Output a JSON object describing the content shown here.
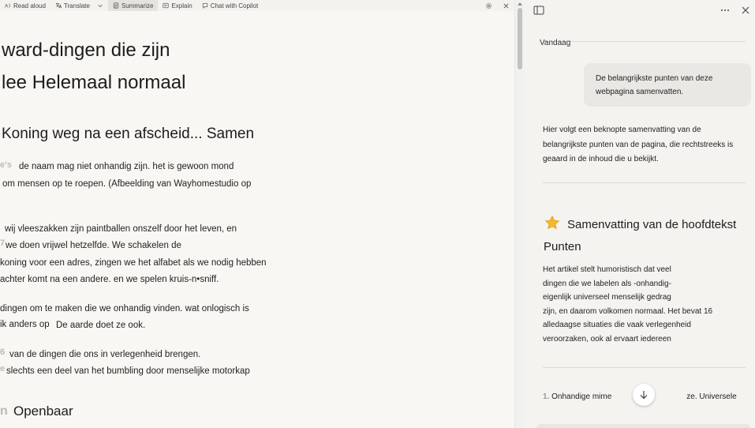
{
  "toolbar": {
    "read_aloud": "Read aloud",
    "translate": "Translate",
    "summarize": "Summarize",
    "explain": "Explain",
    "chat": "Chat with Copilot"
  },
  "article": {
    "headline_1": "ward-dingen die zijn",
    "headline_2": "lee Helemaal normaal",
    "subhead_1": "Koning weg na een afscheid... Samen",
    "subhead_2": "Openbaar",
    "ghost_1": "e's",
    "ghost_2": "7",
    "ghost_3": "6",
    "ghost_4": "e",
    "ghost_5": "n",
    "para_1_line_1": "de naam mag niet onhandig zijn. het is gewoon mond",
    "para_1_line_2": "om mensen op te roepen. (Afbeelding van Wayhomestudio op",
    "para_2_line_1": "wij vleeszakken zijn paintballen onszelf door het leven, en",
    "para_2_line_2": "we doen vrijwel hetzelfde. We schakelen de",
    "para_2_line_3": "koning voor een adres, zingen we het alfabet als we nodig hebben",
    "para_2_line_4": "achter komt na een andere. en we spelen kruis-n•sniff.",
    "para_3_line_1": "dingen om te maken die we onhandig vinden. wat onlogisch is",
    "para_3_line_2a": "ik anders op",
    "para_3_line_2b": "De aarde doet ze ook.",
    "para_4_line_1": "van de dingen die ons in verlegenheid brengen.",
    "para_4_line_2": "slechts een deel van het bumbling door menselijke motorkap"
  },
  "pane": {
    "date": "Vandaag",
    "user_message": "De belangrijkste punten van deze webpagina samenvatten.",
    "response_intro": "Hier volgt een beknopte samenvatting van de belangrijkste punten van de pagina, die rechtstreeks is geaard in de inhoud die u bekijkt.",
    "summary_title": "Samenvatting van de hoofdtekst Punten",
    "summary_line_1": "Het artikel stelt humoristisch dat veel",
    "summary_line_2": "dingen die we labelen als -onhandig-",
    "summary_line_3": "eigenlijk universeel menselijk gedrag",
    "summary_line_4": "zijn, en daarom volkomen normaal. Het bevat 16",
    "summary_line_5": "alledaagse situaties die vaak verlegenheid",
    "summary_line_6": "veroorzaken, ook al ervaart iedereen",
    "item_number": "1.",
    "item_text_a": "Onhandige mime",
    "item_text_b": "ze. Universele"
  },
  "colors": {
    "article_bg": "#f8f7f3",
    "pane_bg": "#f4f3f0",
    "bubble_bg": "#e9e8e4",
    "star": "#f2b82c"
  },
  "icons": [
    "read-aloud-icon",
    "translate-icon",
    "summarize-icon",
    "explain-icon",
    "chat-icon",
    "settings-icon",
    "close-icon",
    "sidebar-toggle-icon",
    "more-icon",
    "star-icon",
    "arrow-down-icon"
  ]
}
